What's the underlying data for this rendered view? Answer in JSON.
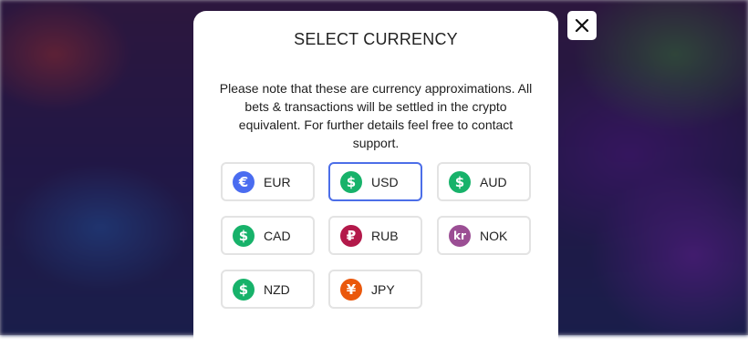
{
  "modal": {
    "title": "SELECT CURRENCY",
    "note": "Please note that these are currency approximations. All bets & transactions will be settled in the crypto equivalent. For further details feel free to contact support.",
    "close_icon": "close-icon",
    "selected_currency": "USD"
  },
  "currencies": [
    {
      "code": "EUR",
      "symbol": "€",
      "icon": "euro-icon",
      "color": "#4a6cf0"
    },
    {
      "code": "USD",
      "symbol": "$",
      "icon": "dollar-icon",
      "color": "#17b26a"
    },
    {
      "code": "AUD",
      "symbol": "$",
      "icon": "dollar-icon",
      "color": "#17b26a"
    },
    {
      "code": "CAD",
      "symbol": "$",
      "icon": "dollar-icon",
      "color": "#17b26a"
    },
    {
      "code": "RUB",
      "symbol": "₽",
      "icon": "ruble-icon",
      "color": "#b3194a"
    },
    {
      "code": "NOK",
      "symbol": "kr",
      "icon": "krone-icon",
      "color": "#9b4e94"
    },
    {
      "code": "NZD",
      "symbol": "$",
      "icon": "dollar-icon",
      "color": "#17b26a"
    },
    {
      "code": "JPY",
      "symbol": "¥",
      "icon": "yen-icon",
      "color": "#ea580c"
    }
  ],
  "colors": {
    "selected_border": "#4c6ee8",
    "default_border": "#e3e3e3"
  }
}
